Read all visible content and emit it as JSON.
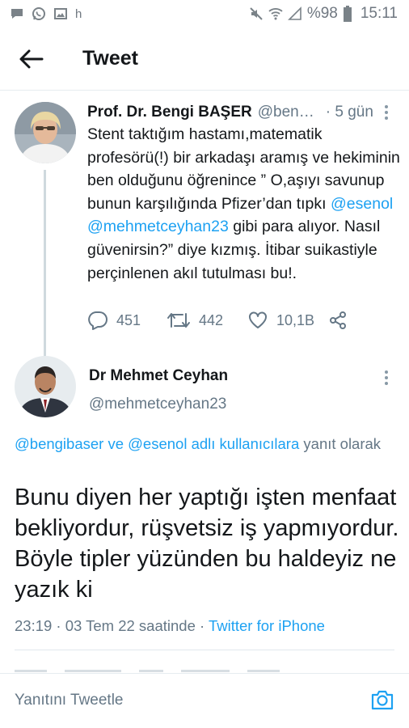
{
  "status_bar": {
    "left_icons": [
      "chat-icon",
      "whatsapp-icon",
      "gallery-icon"
    ],
    "left_text": "h",
    "battery_percent": "%98",
    "time": "15:11"
  },
  "app_bar": {
    "title": "Tweet"
  },
  "tweet1": {
    "author_name": "Prof. Dr. Bengi BAŞER",
    "author_handle": "@ben…",
    "time": "· 5 gün",
    "body": {
      "part1": "Stent taktığım hastamı,matematik profesörü(!) bir arkadaşı aramış ve hekiminin ben olduğunu öğrenince ” O,aşıyı savunup bunun karşılığında Pfizer’dan tıpkı ",
      "mention1": "@esenol",
      "mention2": "@mehmetceyhan23",
      "part2": " gibi para alıyor. Nasıl güvenirsin?” diye kızmış. İtibar suikastiyle perçinlenen akıl tutulması bu!."
    },
    "replies": "451",
    "retweets": "442",
    "likes": "10,1B"
  },
  "tweet2": {
    "author_name": "Dr Mehmet Ceyhan",
    "author_handle": "@mehmetceyhan23",
    "reply_to": {
      "mentions": "@bengibaser ve @esenol adlı kullanıcılara",
      "suffix": " yanıt olarak"
    },
    "body": "Bunu diyen her yaptığı işten menfaat bekliyordur, rüşvetsiz iş yapmıyordur. Böyle tipler yüzünden bu haldeyiz ne yazık ki",
    "timestamp": "23:19 · 03 Tem 22 saatinde · ",
    "source_app": "Twitter for iPhone"
  },
  "reply_bar": {
    "placeholder": "Yanıtını Tweetle"
  },
  "colors": {
    "accent": "#1da1f2",
    "text": "#14171a",
    "muted": "#657786"
  }
}
